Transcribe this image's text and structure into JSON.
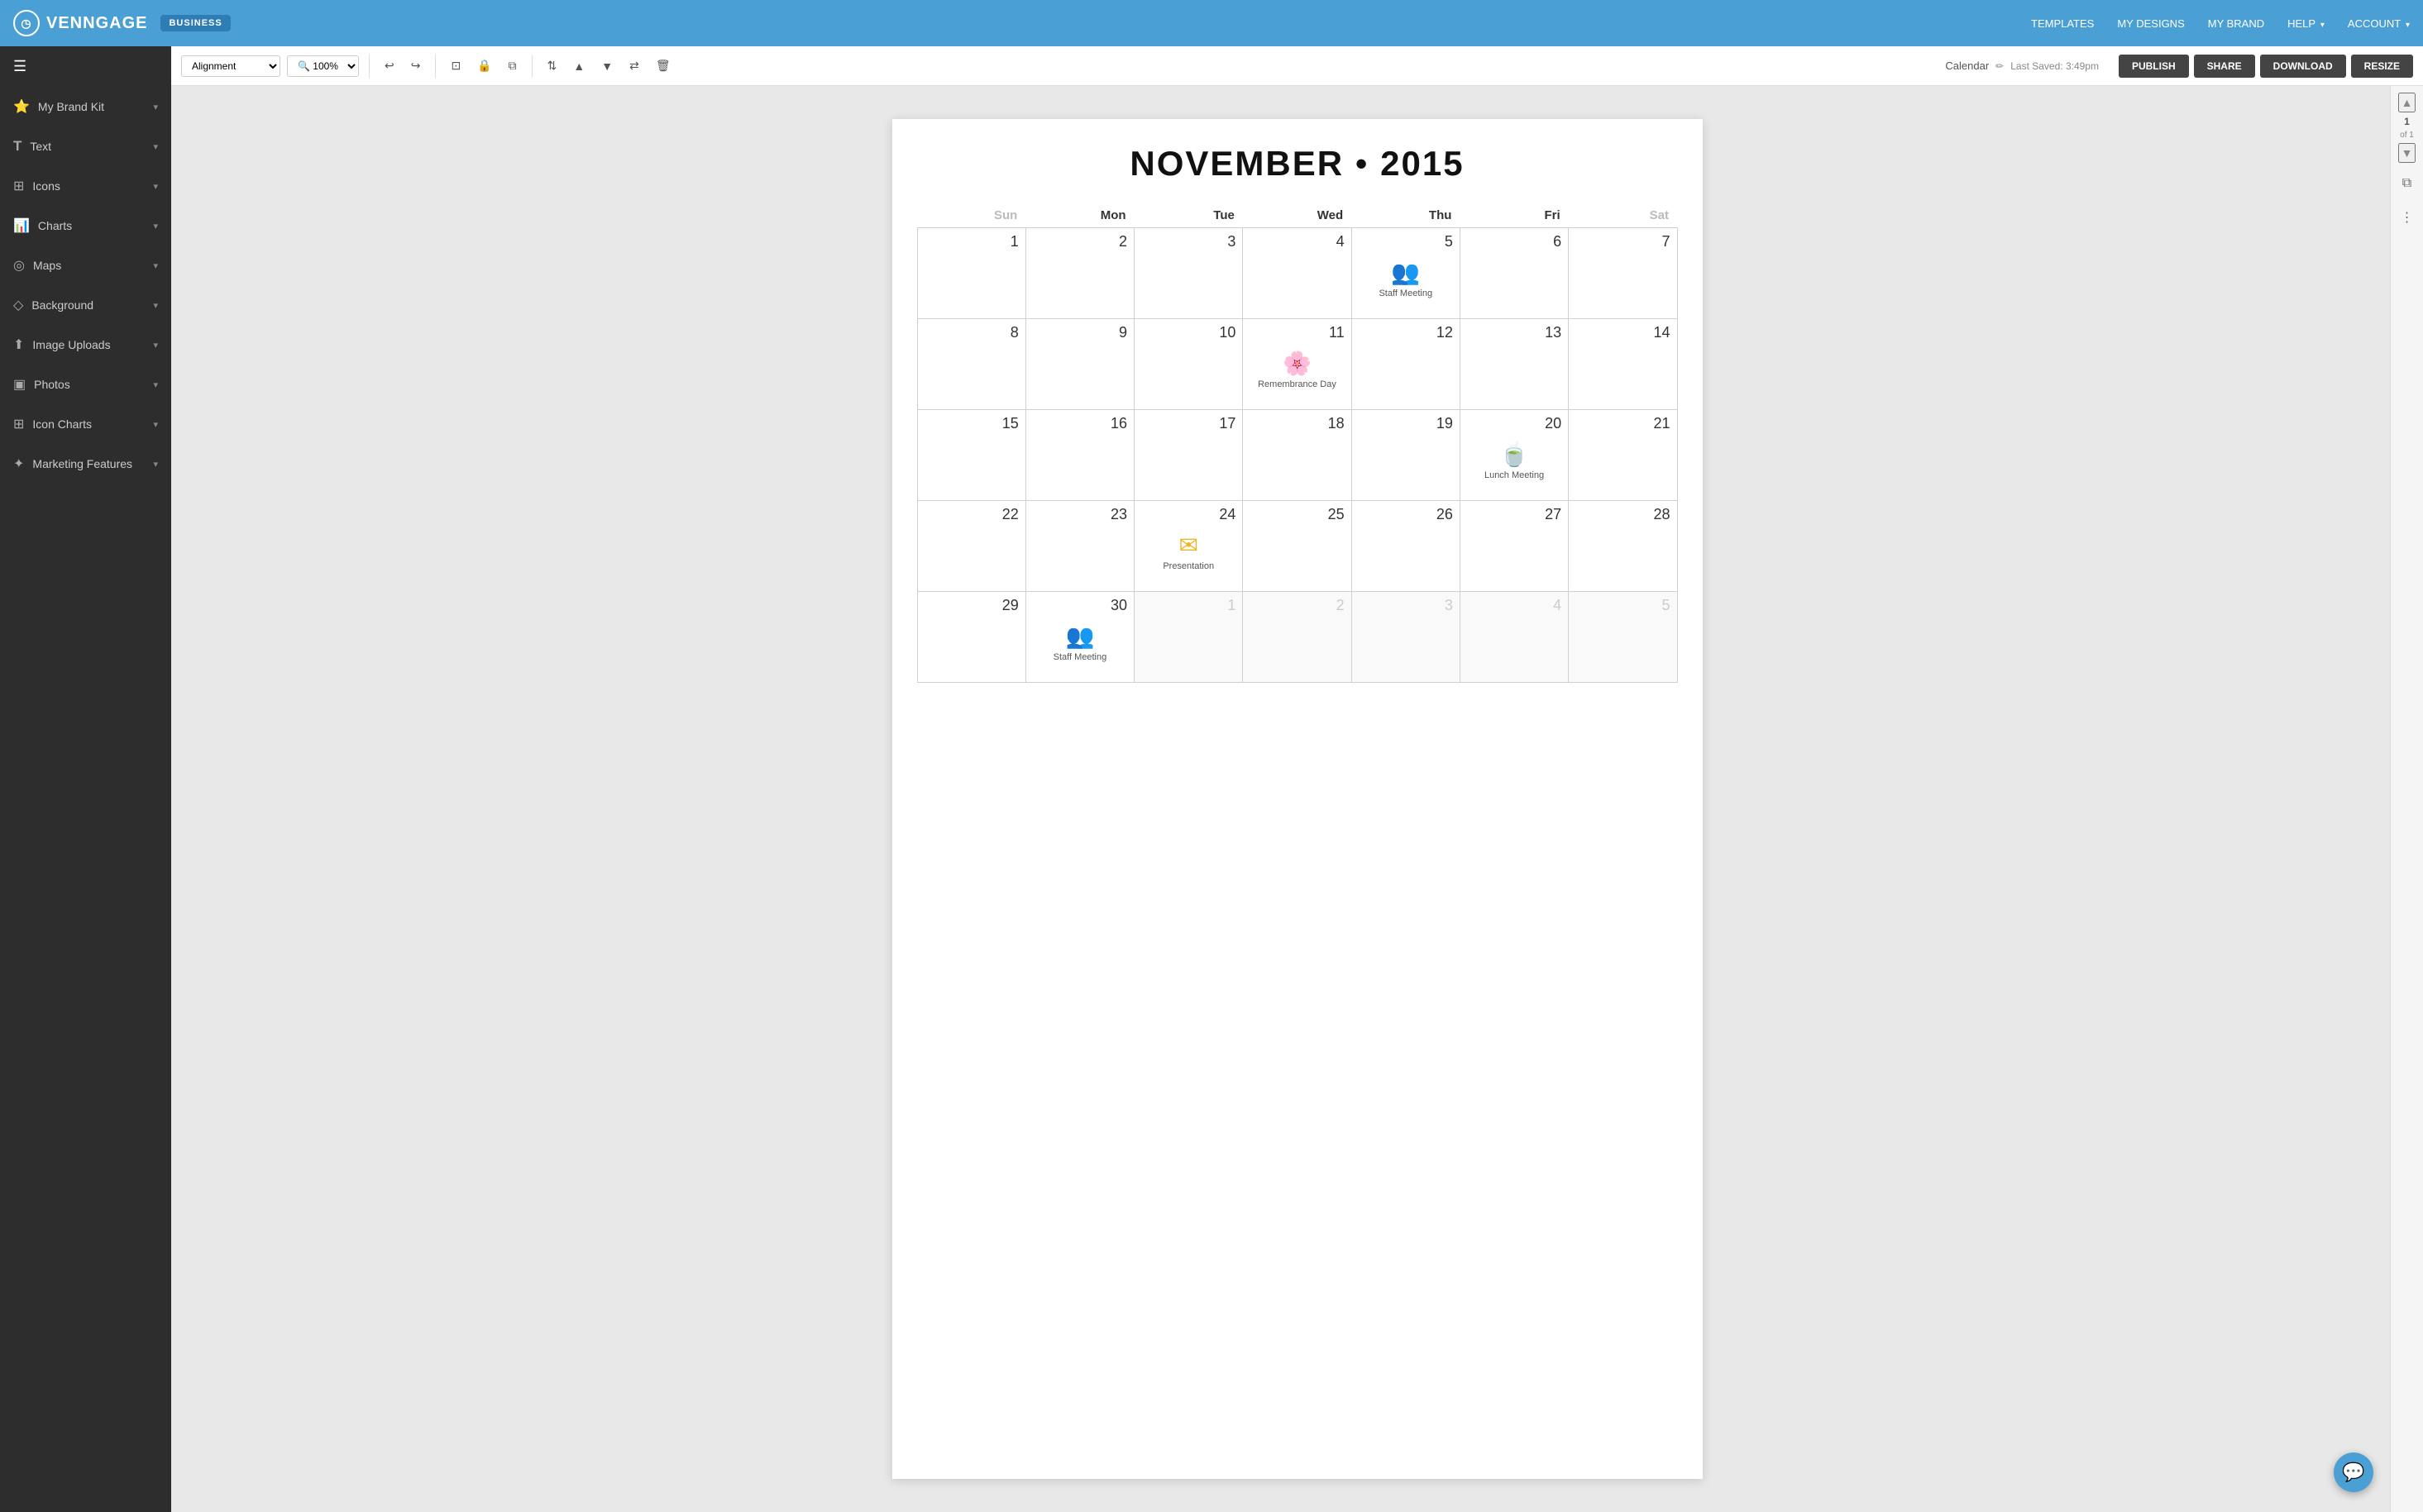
{
  "app": {
    "name": "VENNGAGE",
    "badge": "BUSINESS"
  },
  "topnav": {
    "links": [
      "TEMPLATES",
      "MY DESIGNS",
      "MY BRAND",
      "HELP",
      "ACCOUNT"
    ],
    "help_arrow": "▾",
    "account_arrow": "▾"
  },
  "toolbar": {
    "alignment_label": "Alignment",
    "zoom_label": "🔍 100%",
    "canvas_title": "Calendar",
    "last_saved": "Last Saved: 3:49pm",
    "publish_label": "PUBLISH",
    "share_label": "SHARE",
    "download_label": "DOWNLOAD",
    "resize_label": "RESIZE"
  },
  "sidebar": {
    "items": [
      {
        "id": "my-brand-kit",
        "icon": "⭐",
        "label": "My Brand Kit"
      },
      {
        "id": "text",
        "icon": "T",
        "label": "Text"
      },
      {
        "id": "icons",
        "icon": "⊞",
        "label": "Icons"
      },
      {
        "id": "charts",
        "icon": "📊",
        "label": "Charts"
      },
      {
        "id": "maps",
        "icon": "◎",
        "label": "Maps"
      },
      {
        "id": "background",
        "icon": "◇",
        "label": "Background"
      },
      {
        "id": "image-uploads",
        "icon": "⬆",
        "label": "Image Uploads"
      },
      {
        "id": "photos",
        "icon": "▣",
        "label": "Photos"
      },
      {
        "id": "icon-charts",
        "icon": "⊞",
        "label": "Icon Charts"
      },
      {
        "id": "marketing-features",
        "icon": "✦",
        "label": "Marketing Features"
      }
    ]
  },
  "calendar": {
    "title": "NOVEMBER",
    "bullet": "•",
    "year": "2015",
    "days_of_week": [
      "Sun",
      "Mon",
      "Tue",
      "Wed",
      "Thu",
      "Fri",
      "Sat"
    ],
    "events": {
      "5": {
        "icon": "👥",
        "label": "Staff Meeting",
        "color": "#5b9bd5"
      },
      "11": {
        "icon": "🌸",
        "label": "Remembrance Day",
        "color": "#e05a4a"
      },
      "20": {
        "icon": "🍵",
        "label": "Lunch Meeting",
        "color": "#5b9bd5"
      },
      "24": {
        "icon": "✉",
        "label": "Presentation",
        "color": "#f0b429"
      },
      "30": {
        "icon": "👥",
        "label": "Staff Meeting",
        "color": "#5b9bd5"
      }
    },
    "weeks": [
      [
        {
          "day": 1,
          "month": "current"
        },
        {
          "day": 2,
          "month": "current"
        },
        {
          "day": 3,
          "month": "current"
        },
        {
          "day": 4,
          "month": "current"
        },
        {
          "day": 5,
          "month": "current",
          "event": "staff-meeting"
        },
        {
          "day": 6,
          "month": "current"
        },
        {
          "day": 7,
          "month": "current"
        }
      ],
      [
        {
          "day": 8,
          "month": "current"
        },
        {
          "day": 9,
          "month": "current"
        },
        {
          "day": 10,
          "month": "current"
        },
        {
          "day": 11,
          "month": "current",
          "event": "remembrance-day"
        },
        {
          "day": 12,
          "month": "current"
        },
        {
          "day": 13,
          "month": "current"
        },
        {
          "day": 14,
          "month": "current"
        }
      ],
      [
        {
          "day": 15,
          "month": "current"
        },
        {
          "day": 16,
          "month": "current"
        },
        {
          "day": 17,
          "month": "current"
        },
        {
          "day": 18,
          "month": "current"
        },
        {
          "day": 19,
          "month": "current"
        },
        {
          "day": 20,
          "month": "current",
          "event": "lunch-meeting"
        },
        {
          "day": 21,
          "month": "current"
        }
      ],
      [
        {
          "day": 22,
          "month": "current"
        },
        {
          "day": 23,
          "month": "current"
        },
        {
          "day": 24,
          "month": "current",
          "event": "presentation"
        },
        {
          "day": 25,
          "month": "current"
        },
        {
          "day": 26,
          "month": "current"
        },
        {
          "day": 27,
          "month": "current"
        },
        {
          "day": 28,
          "month": "current"
        }
      ],
      [
        {
          "day": 29,
          "month": "current"
        },
        {
          "day": 30,
          "month": "current",
          "event": "staff-meeting-2"
        },
        {
          "day": 1,
          "month": "next"
        },
        {
          "day": 2,
          "month": "next"
        },
        {
          "day": 3,
          "month": "next"
        },
        {
          "day": 4,
          "month": "next"
        },
        {
          "day": 5,
          "month": "next"
        }
      ]
    ]
  },
  "right_panel": {
    "page_num": "1",
    "page_of": "of 1"
  },
  "chat_btn": {
    "icon": "💬"
  }
}
